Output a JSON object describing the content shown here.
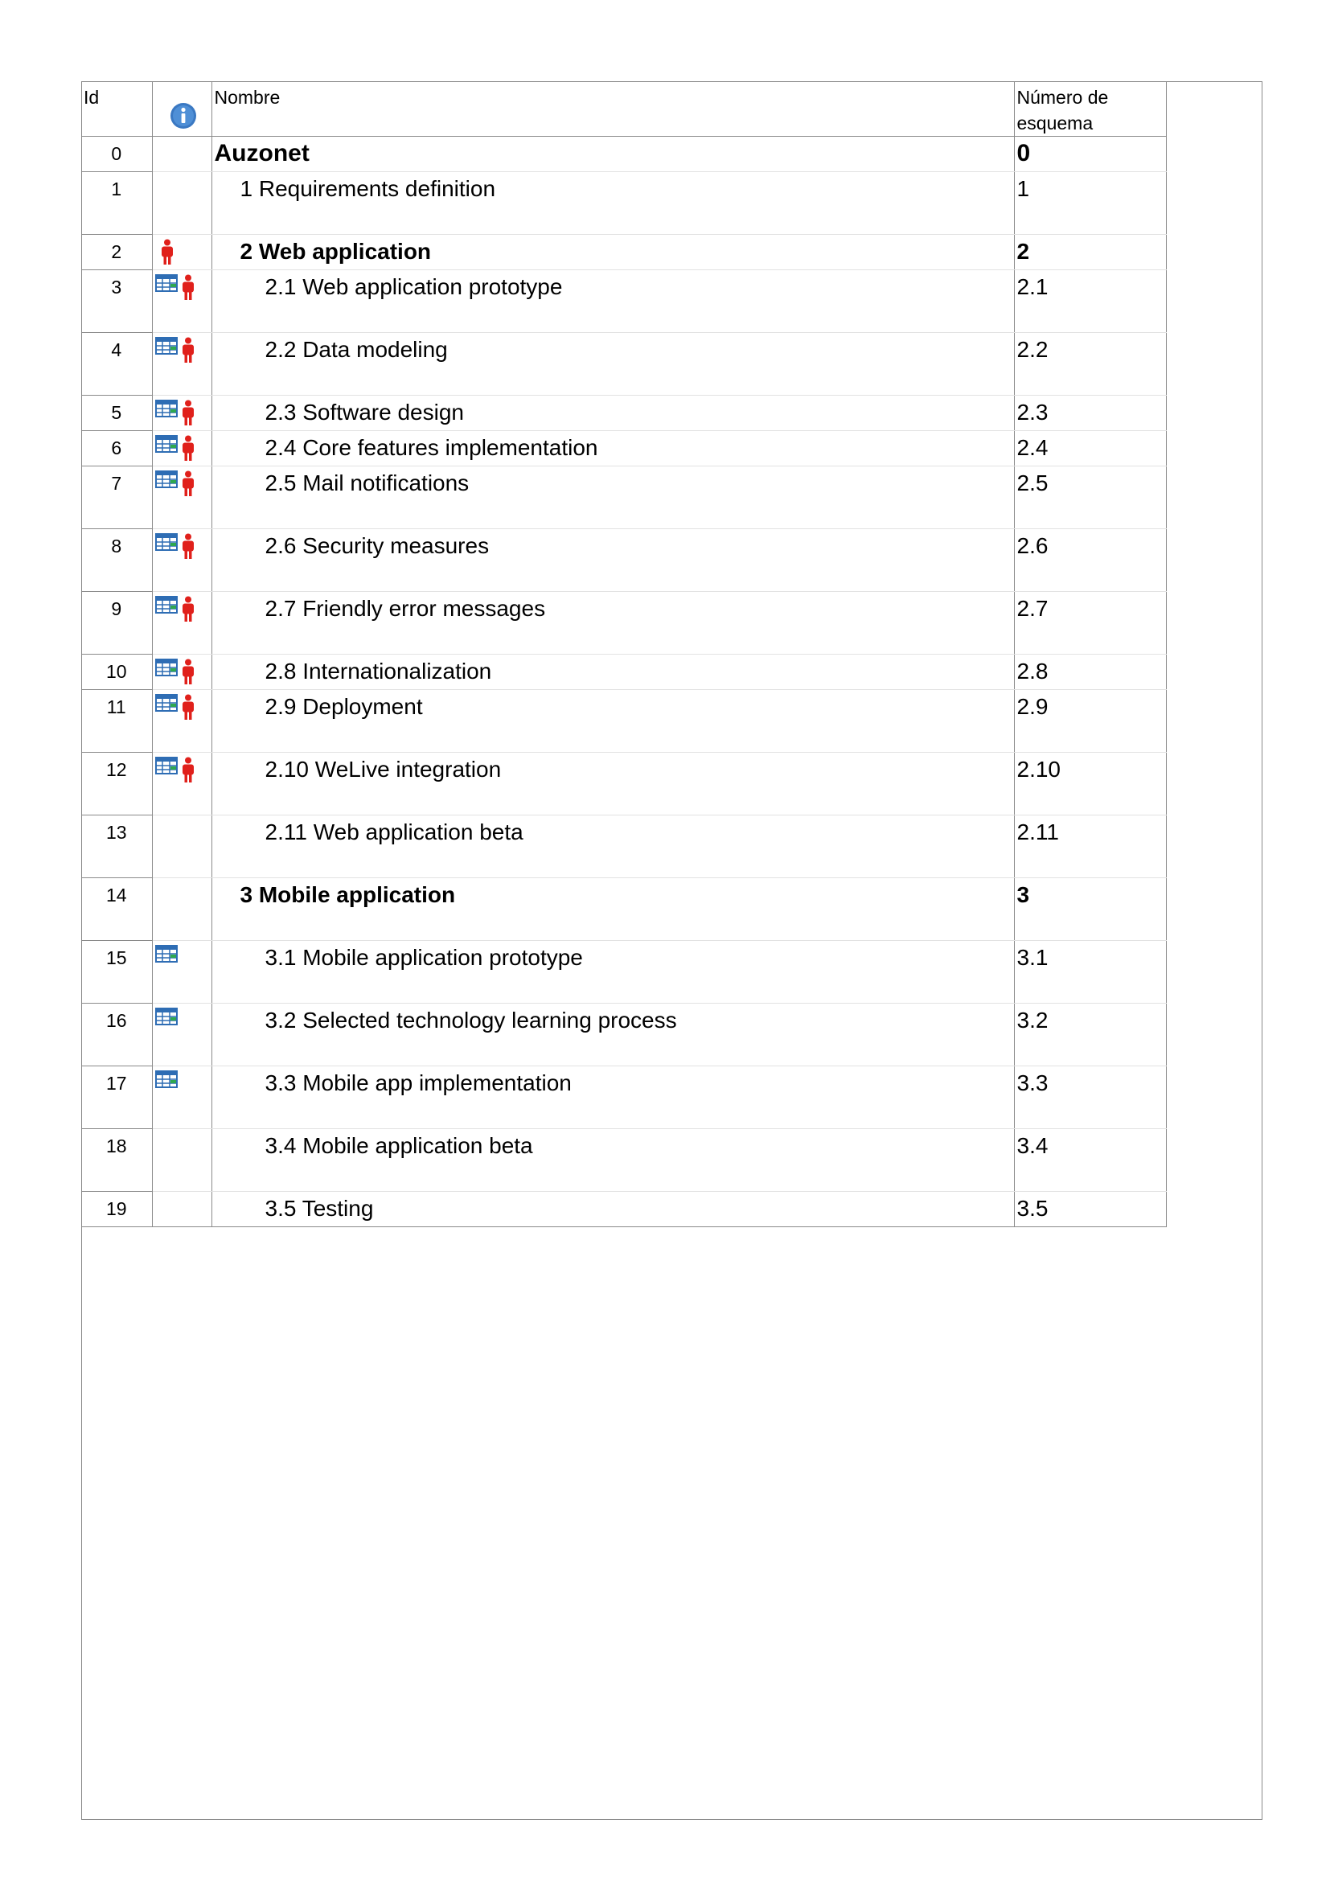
{
  "columns": {
    "id": "Id",
    "indicators_icon": "info-icon",
    "name": "Nombre",
    "wbs": "Número de esquema"
  },
  "colors": {
    "border": "#8a8a8a",
    "resource_icon": "#e0201b",
    "calendar_icon": "#2e6db4",
    "info_icon": "#3a78c2"
  },
  "rows": [
    {
      "id": "0",
      "name": "Auzonet",
      "wbs": "0",
      "level": 0,
      "bold": true,
      "calendar": false,
      "resource": false,
      "tall": false
    },
    {
      "id": "1",
      "name": "1 Requirements definition",
      "wbs": "1",
      "level": 1,
      "bold": false,
      "calendar": false,
      "resource": false,
      "tall": true
    },
    {
      "id": "2",
      "name": "2 Web application",
      "wbs": "2",
      "level": 1,
      "bold": true,
      "calendar": false,
      "resource": true,
      "tall": false
    },
    {
      "id": "3",
      "name": "2.1 Web application prototype",
      "wbs": "2.1",
      "level": 2,
      "bold": false,
      "calendar": true,
      "resource": true,
      "tall": true
    },
    {
      "id": "4",
      "name": "2.2 Data modeling",
      "wbs": "2.2",
      "level": 2,
      "bold": false,
      "calendar": true,
      "resource": true,
      "tall": true
    },
    {
      "id": "5",
      "name": "2.3 Software design",
      "wbs": "2.3",
      "level": 2,
      "bold": false,
      "calendar": true,
      "resource": true,
      "tall": false
    },
    {
      "id": "6",
      "name": "2.4 Core features implementation",
      "wbs": "2.4",
      "level": 2,
      "bold": false,
      "calendar": true,
      "resource": true,
      "tall": false
    },
    {
      "id": "7",
      "name": "2.5 Mail notifications",
      "wbs": "2.5",
      "level": 2,
      "bold": false,
      "calendar": true,
      "resource": true,
      "tall": true
    },
    {
      "id": "8",
      "name": "2.6 Security measures",
      "wbs": "2.6",
      "level": 2,
      "bold": false,
      "calendar": true,
      "resource": true,
      "tall": true
    },
    {
      "id": "9",
      "name": "2.7 Friendly error messages",
      "wbs": "2.7",
      "level": 2,
      "bold": false,
      "calendar": true,
      "resource": true,
      "tall": true
    },
    {
      "id": "10",
      "name": "2.8 Internationalization",
      "wbs": "2.8",
      "level": 2,
      "bold": false,
      "calendar": true,
      "resource": true,
      "tall": false
    },
    {
      "id": "11",
      "name": "2.9 Deployment",
      "wbs": "2.9",
      "level": 2,
      "bold": false,
      "calendar": true,
      "resource": true,
      "tall": true
    },
    {
      "id": "12",
      "name": "2.10 WeLive integration",
      "wbs": "2.10",
      "level": 2,
      "bold": false,
      "calendar": true,
      "resource": true,
      "tall": true
    },
    {
      "id": "13",
      "name": "2.11 Web application beta",
      "wbs": "2.11",
      "level": 2,
      "bold": false,
      "calendar": false,
      "resource": false,
      "tall": true
    },
    {
      "id": "14",
      "name": "3 Mobile application",
      "wbs": "3",
      "level": 1,
      "bold": true,
      "calendar": false,
      "resource": false,
      "tall": true
    },
    {
      "id": "15",
      "name": "3.1 Mobile application prototype",
      "wbs": "3.1",
      "level": 2,
      "bold": false,
      "calendar": true,
      "resource": false,
      "tall": true
    },
    {
      "id": "16",
      "name": "3.2 Selected technology learning process",
      "wbs": "3.2",
      "level": 2,
      "bold": false,
      "calendar": true,
      "resource": false,
      "tall": true
    },
    {
      "id": "17",
      "name": "3.3 Mobile app implementation",
      "wbs": "3.3",
      "level": 2,
      "bold": false,
      "calendar": true,
      "resource": false,
      "tall": true
    },
    {
      "id": "18",
      "name": "3.4 Mobile application beta",
      "wbs": "3.4",
      "level": 2,
      "bold": false,
      "calendar": false,
      "resource": false,
      "tall": true
    },
    {
      "id": "19",
      "name": "3.5 Testing",
      "wbs": "3.5",
      "level": 2,
      "bold": false,
      "calendar": false,
      "resource": false,
      "tall": false
    }
  ]
}
